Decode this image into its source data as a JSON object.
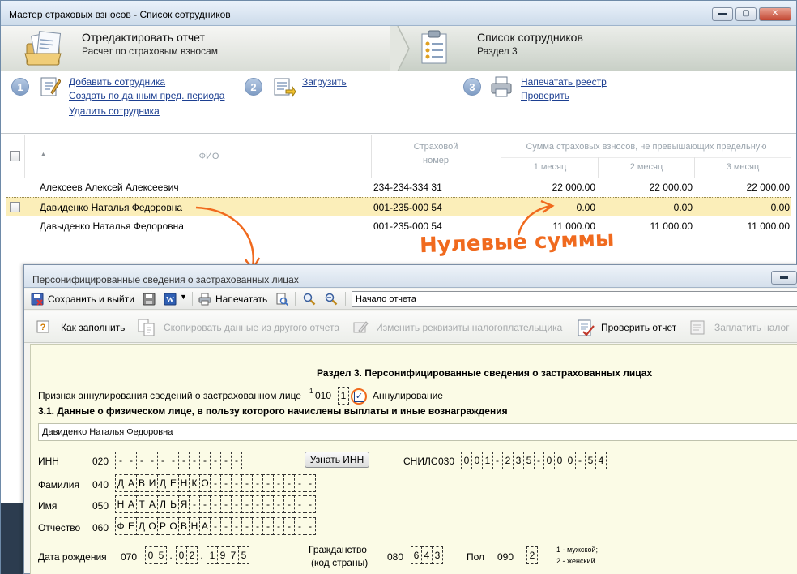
{
  "window": {
    "title": "Мастер страховых взносов - Список сотрудников",
    "controls": {
      "minimize": "▬",
      "maximize": "▢",
      "close": "✕"
    }
  },
  "wizard": {
    "step1_title": "Отредактировать отчет",
    "step1_sub": "Расчет по страховым взносам",
    "step2_title": "Список сотрудников",
    "step2_sub": "Раздел 3"
  },
  "actions": {
    "n1": "1",
    "n2": "2",
    "n3": "3",
    "add_employee": "Добавить сотрудника",
    "create_prev": "Создать по данным пред. периода",
    "delete_employee": "Удалить сотрудника",
    "load": "Загрузить",
    "print_registry": "Напечатать реестр",
    "check": "Проверить"
  },
  "grid": {
    "col_fio": "ФИО",
    "col_insurance_1": "Страховой",
    "col_insurance_2": "номер",
    "col_sum": "Сумма страховых взносов, не превышающих предельную",
    "col_m1": "1 месяц",
    "col_m2": "2 месяц",
    "col_m3": "3 месяц",
    "rows": [
      {
        "fio": "Алексеев Алексей Алексеевич",
        "snils": "234-234-334 31",
        "m1": "22 000.00",
        "m2": "22 000.00",
        "m3": "22 000.00"
      },
      {
        "fio": "Давиденко Наталья Федоровна",
        "snils": "001-235-000 54",
        "m1": "0.00",
        "m2": "0.00",
        "m3": "0.00"
      },
      {
        "fio": "Давыденко Наталья Федоровна",
        "snils": "001-235-000 54",
        "m1": "11 000.00",
        "m2": "11 000.00",
        "m3": "11 000.00"
      }
    ]
  },
  "annotation": "Нулевые суммы",
  "dialog": {
    "title": "Персонифицированные сведения о застрахованных лицах",
    "toolbar1": {
      "save_exit": "Сохранить и выйти",
      "print": "Напечатать",
      "nav_select": "Начало отчета"
    },
    "toolbar2": {
      "how_to_fill": "Как заполнить",
      "copy_from": "Скопировать данные из другого отчета",
      "change_details": "Изменить реквизиты налогоплательщика",
      "check_report": "Проверить отчет",
      "pay_tax": "Заплатить налог"
    },
    "form": {
      "section_title": "Раздел 3. Персонифицированные сведения о застрахованных лицах",
      "cancel_label": "Признак аннулирования сведений о застрахованном лице",
      "cancel_sup": "1",
      "cancel_code": "010",
      "cancel_value": "1",
      "cancel_checkbox_label": "Аннулирование",
      "sub_title": "3.1. Данные о физическом лице, в пользу которого начислены выплаты и иные вознаграждения",
      "person_name": "Давиденко Наталья Федоровна",
      "inn_label": "ИНН",
      "inn_code": "020",
      "inn_cells": [
        "-",
        "-",
        "-",
        "-",
        "-",
        "-",
        "-",
        "-",
        "-",
        "-",
        "-",
        "-"
      ],
      "find_inn_button": "Узнать ИНН",
      "snils_label": "СНИЛС",
      "snils_code": "030",
      "snils_groups": [
        [
          "0",
          "0",
          "1"
        ],
        [
          "2",
          "3",
          "5"
        ],
        [
          "0",
          "0",
          "0"
        ],
        [
          "5",
          "4"
        ]
      ],
      "snils_seps": [
        "-",
        "-",
        "-"
      ],
      "surname_label": "Фамилия",
      "surname_code": "040",
      "surname_cells": [
        "Д",
        "А",
        "В",
        "И",
        "Д",
        "Е",
        "Н",
        "К",
        "О",
        "-",
        "-",
        "-",
        "-",
        "-",
        "-",
        "-",
        "-",
        "-",
        "-",
        "-",
        "-",
        "-",
        "-",
        "-",
        "-",
        "-",
        "-",
        "-",
        "-",
        "-",
        "-",
        "-",
        "-",
        "-",
        "-",
        "-",
        "-",
        "-",
        "-",
        "-"
      ],
      "name_label": "Имя",
      "name_code": "050",
      "name_cells": [
        "Н",
        "А",
        "Т",
        "А",
        "Л",
        "Ь",
        "Я",
        "-",
        "-",
        "-",
        "-",
        "-",
        "-",
        "-",
        "-",
        "-",
        "-",
        "-",
        "-",
        "-",
        "-",
        "-",
        "-",
        "-",
        "-",
        "-",
        "-",
        "-",
        "-",
        "-",
        "-",
        "-",
        "-",
        "-",
        "-",
        "-",
        "-",
        "-",
        "-",
        "-"
      ],
      "patronymic_label": "Отчество",
      "patronymic_code": "060",
      "patronymic_cells": [
        "Ф",
        "Е",
        "Д",
        "О",
        "Р",
        "О",
        "В",
        "Н",
        "А",
        "-",
        "-",
        "-",
        "-",
        "-",
        "-",
        "-",
        "-",
        "-",
        "-",
        "-",
        "-",
        "-",
        "-",
        "-",
        "-",
        "-",
        "-",
        "-",
        "-",
        "-",
        "-",
        "-",
        "-",
        "-",
        "-",
        "-",
        "-",
        "-",
        "-",
        "-"
      ],
      "birth_label": "Дата рождения",
      "birth_code": "070",
      "birth_day": [
        "0",
        "5"
      ],
      "birth_month": [
        "0",
        "2"
      ],
      "birth_year": [
        "1",
        "9",
        "7",
        "5"
      ],
      "birth_sep": ".",
      "citizenship_label_1": "Гражданство",
      "citizenship_label_2": "(код страны)",
      "citizenship_code": "080",
      "citizenship_cells": [
        "6",
        "4",
        "3"
      ],
      "gender_label": "Пол",
      "gender_code": "090",
      "gender_cells": [
        "2"
      ],
      "gender_hint_1": "1 - мужской;",
      "gender_hint_2": "2 - женский."
    }
  },
  "colors": {
    "accent_orange": "#f06a1e",
    "selected_row": "#fbeeb9",
    "form_bg": "#fbfbe6",
    "link": "#1c3f91"
  }
}
